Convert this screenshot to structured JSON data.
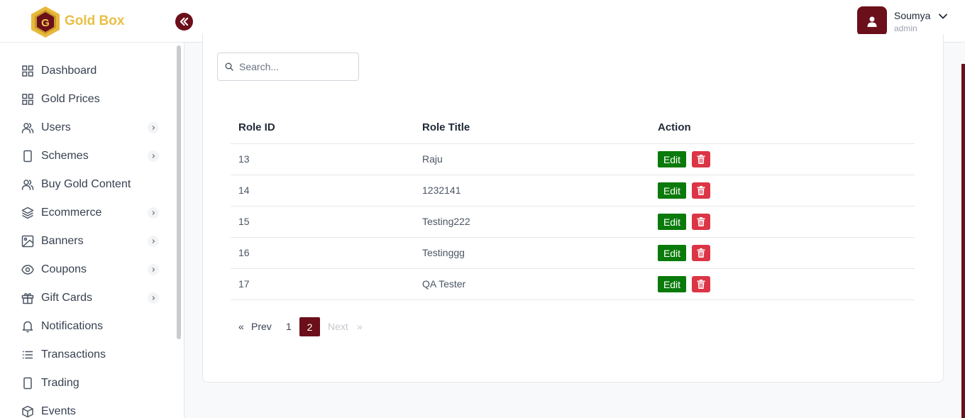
{
  "app": {
    "brand": "Gold Box"
  },
  "user": {
    "name": "Soumya",
    "role": "admin"
  },
  "sidebar": {
    "items": [
      {
        "label": "Dashboard",
        "icon": "grid-icon",
        "has_submenu": false
      },
      {
        "label": "Gold Prices",
        "icon": "grid-icon",
        "has_submenu": false
      },
      {
        "label": "Users",
        "icon": "users-icon",
        "has_submenu": true
      },
      {
        "label": "Schemes",
        "icon": "tablet-icon",
        "has_submenu": true
      },
      {
        "label": "Buy Gold Content",
        "icon": "users-icon",
        "has_submenu": false
      },
      {
        "label": "Ecommerce",
        "icon": "layers-icon",
        "has_submenu": true
      },
      {
        "label": "Banners",
        "icon": "image-icon",
        "has_submenu": true
      },
      {
        "label": "Coupons",
        "icon": "eye-icon",
        "has_submenu": true
      },
      {
        "label": "Gift Cards",
        "icon": "gift-icon",
        "has_submenu": true
      },
      {
        "label": "Notifications",
        "icon": "bell-icon",
        "has_submenu": false
      },
      {
        "label": "Transactions",
        "icon": "list-icon",
        "has_submenu": false
      },
      {
        "label": "Trading",
        "icon": "tablet-icon",
        "has_submenu": false
      },
      {
        "label": "Events",
        "icon": "box-icon",
        "has_submenu": false
      }
    ]
  },
  "search": {
    "placeholder": "Search...",
    "value": ""
  },
  "table": {
    "headers": [
      "Role ID",
      "Role Title",
      "Action"
    ],
    "rows": [
      {
        "id": "13",
        "title": "Raju"
      },
      {
        "id": "14",
        "title": "1232141"
      },
      {
        "id": "15",
        "title": "Testing222"
      },
      {
        "id": "16",
        "title": "Testinggg"
      },
      {
        "id": "17",
        "title": "QA Tester"
      }
    ],
    "edit_label": "Edit"
  },
  "pagination": {
    "prev_symbol": "«",
    "prev_label": "Prev",
    "pages": [
      "1",
      "2"
    ],
    "current_page": "2",
    "next_label": "Next",
    "next_symbol": "»"
  },
  "colors": {
    "primary": "#6b0f1a",
    "brand_gold": "#e8c046",
    "edit_green": "#0a7a0a",
    "delete_red": "#dc3545"
  }
}
